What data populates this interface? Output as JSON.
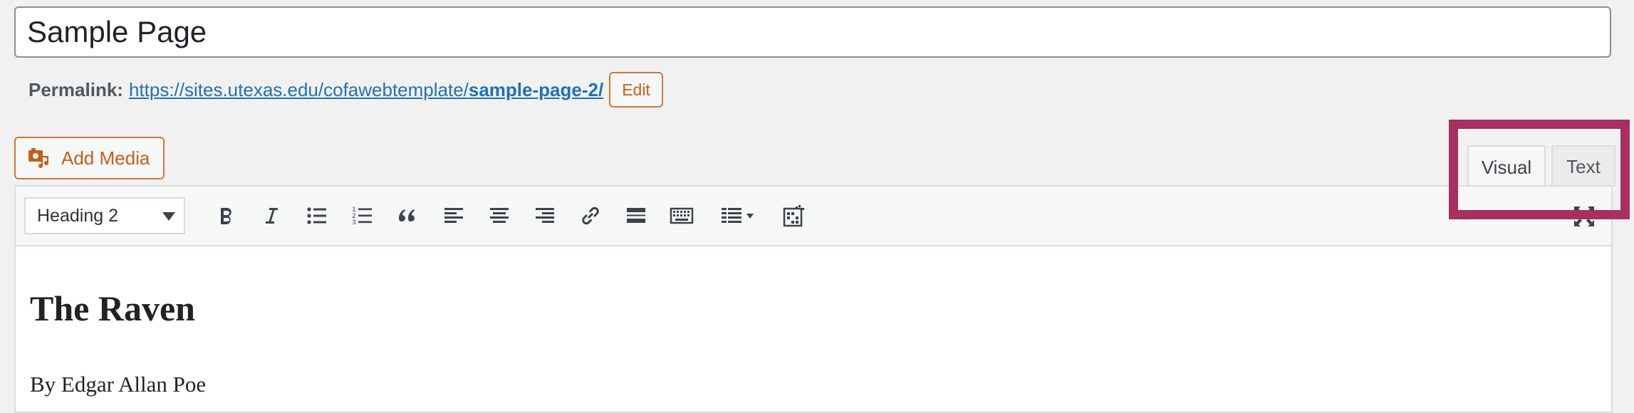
{
  "title_field": {
    "value": "Sample Page"
  },
  "permalink": {
    "label": "Permalink:",
    "url_prefix": "https://sites.utexas.edu/cofawebtemplate/",
    "url_slug": "sample-page-2/",
    "edit_label": "Edit"
  },
  "media": {
    "add_media_label": "Add Media",
    "icon": "media-icon"
  },
  "tabs": [
    {
      "label": "Visual",
      "active": true
    },
    {
      "label": "Text",
      "active": false
    }
  ],
  "toolbar": {
    "format_select": "Heading 2",
    "buttons": [
      "bold-icon",
      "italic-icon",
      "bullet-list-icon",
      "numbered-list-icon",
      "blockquote-icon",
      "align-left-icon",
      "align-center-icon",
      "align-right-icon",
      "link-icon",
      "read-more-icon",
      "toolbar-toggle-icon",
      "table-icon",
      "plugin-grid-icon",
      "fullscreen-icon"
    ]
  },
  "content": {
    "heading": "The Raven",
    "byline": "By Edgar Allan Poe"
  },
  "colors": {
    "accent_orange": "#c45f1c",
    "link_blue": "#2271b1",
    "highlight": "#a7305f"
  }
}
